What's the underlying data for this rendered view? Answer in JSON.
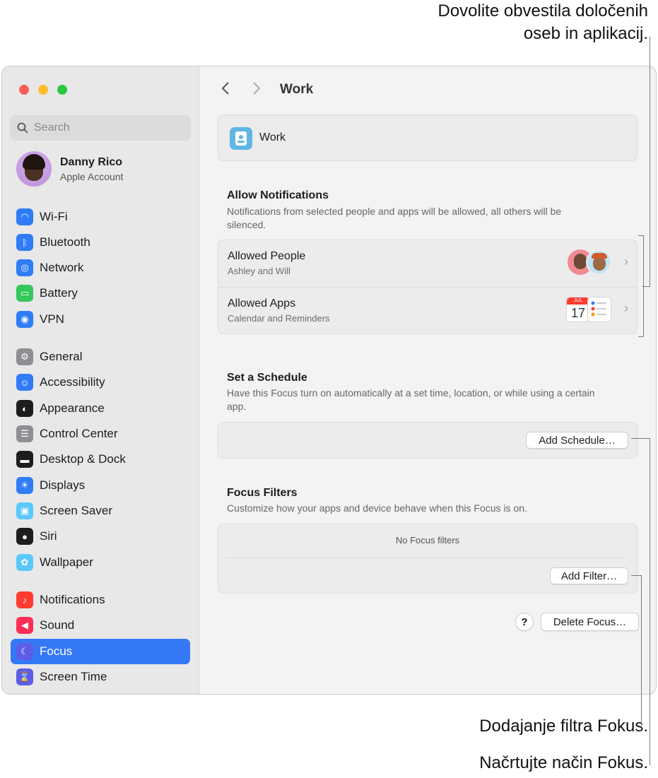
{
  "callouts": {
    "top": "Dovolite obvestila določenih\noseb in aplikacij.",
    "filter": "Dodajanje filtra Fokus.",
    "schedule": "Načrtujte način Fokus."
  },
  "sidebar": {
    "search_placeholder": "Search",
    "profile": {
      "name": "Danny Rico",
      "subtitle": "Apple Account"
    },
    "items": [
      {
        "label": "Wi-Fi",
        "icon": "wifi-icon",
        "color": "#2f7cf6"
      },
      {
        "label": "Bluetooth",
        "icon": "bluetooth-icon",
        "color": "#2f7cf6"
      },
      {
        "label": "Network",
        "icon": "globe-icon",
        "color": "#2f7cf6"
      },
      {
        "label": "Battery",
        "icon": "battery-icon",
        "color": "#34c759"
      },
      {
        "label": "VPN",
        "icon": "vpn-globe-icon",
        "color": "#2f7cf6"
      },
      {
        "label": "General",
        "icon": "gear-icon",
        "color": "#8e8e93"
      },
      {
        "label": "Accessibility",
        "icon": "accessibility-icon",
        "color": "#2f7cf6"
      },
      {
        "label": "Appearance",
        "icon": "appearance-icon",
        "color": "#1d1d1f"
      },
      {
        "label": "Control Center",
        "icon": "control-center-icon",
        "color": "#8e8e93"
      },
      {
        "label": "Desktop & Dock",
        "icon": "dock-icon",
        "color": "#1d1d1f"
      },
      {
        "label": "Displays",
        "icon": "sun-icon",
        "color": "#2f7cf6"
      },
      {
        "label": "Screen Saver",
        "icon": "screen-saver-icon",
        "color": "#5ac8fa"
      },
      {
        "label": "Siri",
        "icon": "siri-icon",
        "color": "#1d1d1f"
      },
      {
        "label": "Wallpaper",
        "icon": "flower-icon",
        "color": "#5ac8fa"
      },
      {
        "label": "Notifications",
        "icon": "bell-icon",
        "color": "#ff3b30"
      },
      {
        "label": "Sound",
        "icon": "speaker-icon",
        "color": "#ff2d55"
      },
      {
        "label": "Focus",
        "icon": "moon-icon",
        "color": "#5e5ce6"
      },
      {
        "label": "Screen Time",
        "icon": "hourglass-icon",
        "color": "#5e5ce6"
      }
    ],
    "active_label": "Focus"
  },
  "main": {
    "title": "Work",
    "focus_name": "Work",
    "allow": {
      "title": "Allow Notifications",
      "desc": "Notifications from selected people and apps will be allowed, all others will be silenced.",
      "people_title": "Allowed People",
      "people_sub": "Ashley and Will",
      "apps_title": "Allowed Apps",
      "apps_sub": "Calendar and Reminders",
      "calendar_month": "JUL",
      "calendar_day": "17"
    },
    "schedule": {
      "title": "Set a Schedule",
      "desc": "Have this Focus turn on automatically at a set time, location, or while using a certain app.",
      "button": "Add Schedule…"
    },
    "filters": {
      "title": "Focus Filters",
      "desc": "Customize how your apps and device behave when this Focus is on.",
      "empty": "No Focus filters",
      "button": "Add Filter…"
    },
    "help": "?",
    "delete_button": "Delete Focus…"
  }
}
